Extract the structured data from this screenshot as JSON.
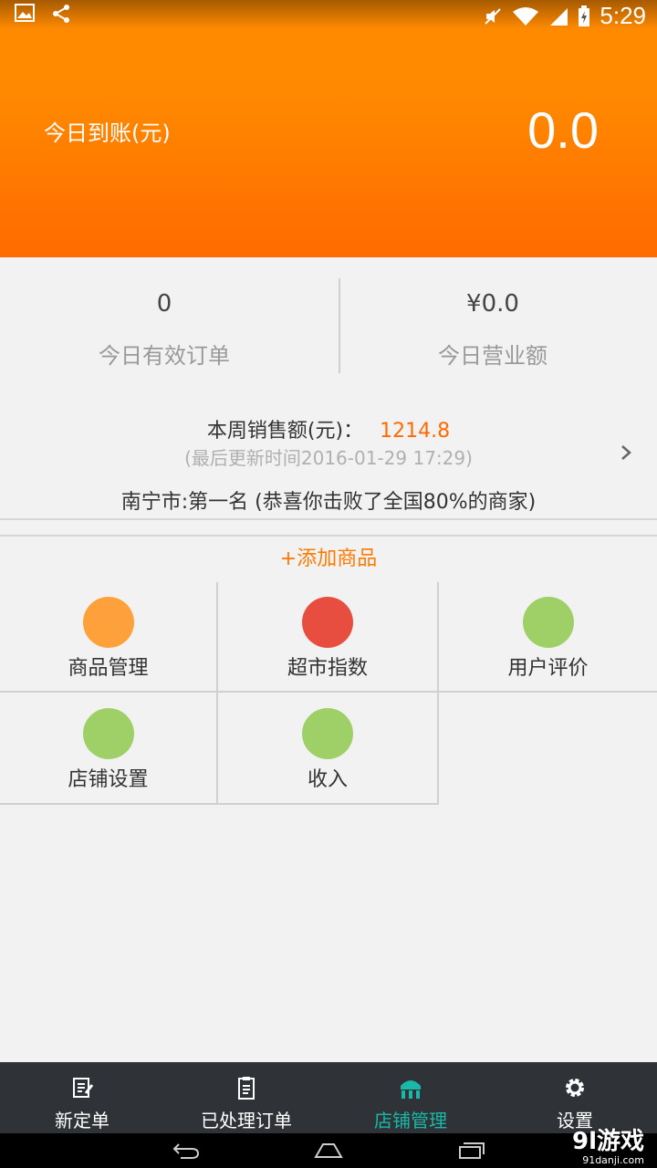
{
  "status_bar": {
    "time": "5:29",
    "icons": [
      "image-icon",
      "share-icon",
      "mute-icon",
      "wifi-icon",
      "signal-icon",
      "battery-charging-icon"
    ]
  },
  "header": {
    "today_label": "今日到账(元)",
    "today_value": "0.0",
    "color": "#ff8a00"
  },
  "stats": [
    {
      "value": "0",
      "label": "今日有效订单"
    },
    {
      "value": "¥0.0",
      "label": "今日营业额"
    }
  ],
  "weekly": {
    "label": "本周销售额(元)：",
    "amount": "1214.8",
    "updated": "(最后更新时间2016-01-29  17:29)",
    "ranking": "南宁市:第一名  (恭喜你击败了全国80%的商家)"
  },
  "add_product": "+添加商品",
  "grid": [
    {
      "label": "商品管理",
      "color": "#ffa13b"
    },
    {
      "label": "超市指数",
      "color": "#e74e3f"
    },
    {
      "label": "用户评价",
      "color": "#9fd067"
    },
    {
      "label": "店铺设置",
      "color": "#9fd067"
    },
    {
      "label": "收入",
      "color": "#9fd067"
    }
  ],
  "bottom_nav": [
    {
      "label": "新定单",
      "icon": "new-order-icon"
    },
    {
      "label": "已处理订单",
      "icon": "clipboard-icon"
    },
    {
      "label": "店铺管理",
      "icon": "shop-icon",
      "active": true
    },
    {
      "label": "设置",
      "icon": "gear-icon"
    }
  ],
  "watermark": {
    "brand": "9l游戏",
    "site": "91danji.com"
  },
  "accent_color": "#19b8a8"
}
